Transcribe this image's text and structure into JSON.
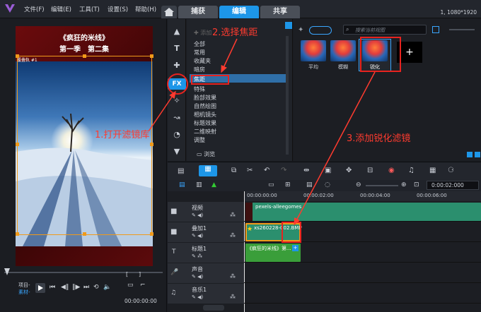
{
  "menu": {
    "items": [
      "文件(F)",
      "编辑(E)",
      "工具(T)",
      "设置(S)",
      "帮助(H)"
    ]
  },
  "tabs": {
    "capture": "捕获",
    "edit": "编辑",
    "share": "共享"
  },
  "resolution": "1, 1080*1920",
  "preview": {
    "title1": "《疯狂的米线》",
    "title2": "第一季　第二集",
    "badge": "覆叠轨 #1",
    "project_label": "项目-",
    "clip_label": "素材-",
    "timecode": "00:00:00:00"
  },
  "library": {
    "add_label": "添加",
    "categories": [
      "全部",
      "常用",
      "收藏夹",
      "暗房",
      "焦距",
      "特殊",
      "脸部效果",
      "自然绘图",
      "相机镜头",
      "标题效果",
      "二维映射",
      "调整"
    ],
    "browse_label": "浏览",
    "search_placeholder": "搜索当前视图",
    "filters": [
      {
        "label": "平均"
      },
      {
        "label": "模糊"
      },
      {
        "label": "锐化"
      }
    ]
  },
  "timeline": {
    "ruler": [
      "00:00:00:00",
      "00:00:02:00",
      "00:00:04:00",
      "00:00:06:00"
    ],
    "timecode": "0:00:02:000",
    "tracks": [
      {
        "name": "视频",
        "clip": "pexels-alleegomes"
      },
      {
        "name": "叠加1",
        "clip": "xs260228-002.BMP"
      },
      {
        "name": "标题1",
        "clip": "《疯狂的米线》第..."
      },
      {
        "name": "声音",
        "clip": ""
      },
      {
        "name": "音乐1",
        "clip": ""
      }
    ]
  },
  "annotations": {
    "step1": "1.打开滤镜库",
    "step2": "2.选择焦距",
    "step3": "3.添加锐化滤镜"
  }
}
